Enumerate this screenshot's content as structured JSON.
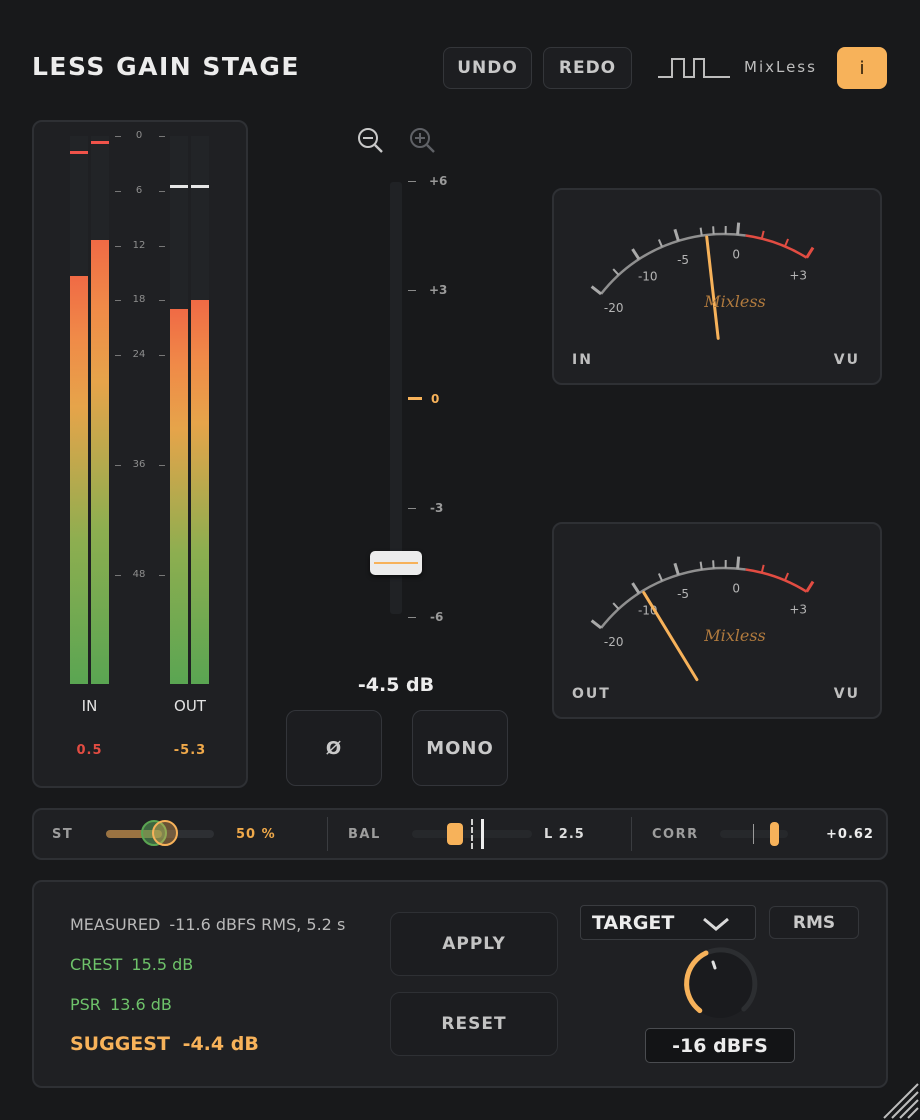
{
  "header": {
    "title": "LESS GAIN STAGE",
    "undo_label": "UNDO",
    "redo_label": "REDO",
    "brand": "MixLess",
    "info_label": "i"
  },
  "meters": {
    "scale": [
      "0",
      "6",
      "12",
      "18",
      "24",
      "36",
      "48"
    ],
    "in_label": "IN",
    "out_label": "OUT",
    "in_value": "0.5",
    "out_value": "-5.3",
    "in_levels": [
      0.745,
      0.81
    ],
    "out_levels": [
      0.685,
      0.7
    ],
    "in_peaks": [
      0.973,
      0.99
    ],
    "out_peaks": [
      0.91,
      0.91
    ]
  },
  "fader": {
    "scale": [
      "+6",
      "+3",
      "0",
      "-3",
      "-6"
    ],
    "value_text": "-4.5 dB",
    "value": -4.5,
    "phase_label": "Ø",
    "mono_label": "MONO"
  },
  "vu_in": {
    "label": "IN",
    "unit": "VU",
    "ticks": [
      "-20",
      "-10",
      "-5",
      "0",
      "+3"
    ],
    "logo": "Mixless",
    "needle_value": -2.6
  },
  "vu_out": {
    "label": "OUT",
    "unit": "VU",
    "ticks": [
      "-20",
      "-10",
      "-5",
      "0",
      "+3"
    ],
    "logo": "Mixless",
    "needle_value": -9.5
  },
  "strip": {
    "st_label": "ST",
    "st_value": "50 %",
    "st_level": 0.5,
    "bal_label": "BAL",
    "bal_value": "L 2.5",
    "corr_label": "CORR",
    "corr_value": "+0.62"
  },
  "analysis": {
    "measured_label": "MEASURED",
    "measured_value": "-11.6 dBFS RMS, 5.2 s",
    "crest_label": "CREST",
    "crest_value": "15.5 dB",
    "psr_label": "PSR",
    "psr_value": "13.6 dB",
    "suggest_label": "SUGGEST",
    "suggest_value": "-4.4 dB",
    "apply_label": "APPLY",
    "reset_label": "RESET",
    "target_label": "TARGET",
    "rms_label": "RMS",
    "target_value": "-16 dBFS"
  },
  "colors": {
    "accent": "#f7b25a",
    "green": "#6ec26a",
    "red": "#e24c42",
    "background": "#18191b"
  }
}
